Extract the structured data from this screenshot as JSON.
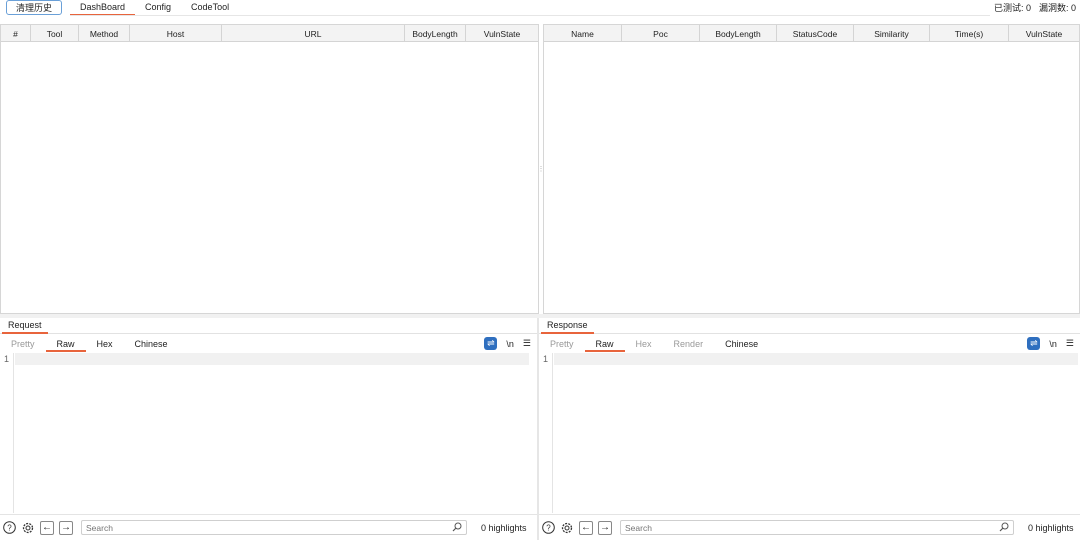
{
  "toolbar": {
    "clear_history_label": "清理历史"
  },
  "top_tabs": [
    {
      "label": "DashBoard",
      "active": true
    },
    {
      "label": "Config",
      "active": false
    },
    {
      "label": "CodeTool",
      "active": false
    }
  ],
  "stats": {
    "tested": "已测试: 0",
    "vulns": "漏洞数: 0"
  },
  "left_table": {
    "columns": [
      "#",
      "Tool",
      "Method",
      "Host",
      "URL",
      "BodyLength",
      "VulnState"
    ],
    "rows": []
  },
  "right_table": {
    "columns": [
      "Name",
      "Poc",
      "BodyLength",
      "StatusCode",
      "Similarity",
      "Time(s)",
      "VulnState"
    ],
    "rows": []
  },
  "request": {
    "title": "Request",
    "tabs": [
      "Pretty",
      "Raw",
      "Hex",
      "Chinese"
    ],
    "active_tab": "Raw",
    "tool_newline": "\\n",
    "line_number": "1",
    "search_placeholder": "Search",
    "highlights": "0 highlights"
  },
  "response": {
    "title": "Response",
    "tabs": [
      "Pretty",
      "Raw",
      "Hex",
      "Render",
      "Chinese"
    ],
    "active_tab": "Raw",
    "tool_newline": "\\n",
    "line_number": "1",
    "search_placeholder": "Search",
    "highlights": "0 highlights"
  },
  "icons": [
    "help-icon",
    "gear-icon",
    "arrow-left-icon",
    "arrow-right-icon",
    "search-icon",
    "wrap-icon",
    "menu-icon"
  ],
  "colors": {
    "accent": "#e8643c",
    "wrap_button": "#2f6fbf"
  }
}
